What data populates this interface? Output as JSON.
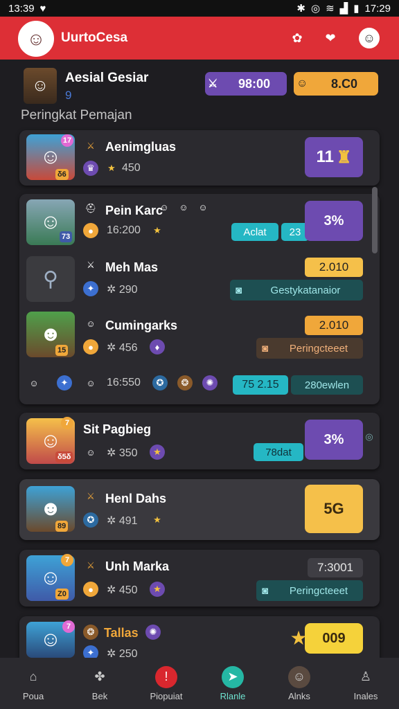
{
  "status_bar": {
    "time_left": "13:39",
    "time_right": "17:29"
  },
  "app": {
    "title": "UurtoCesa"
  },
  "header": {
    "name": "Aesial Gesiar",
    "sub": "9",
    "pill_1": "98:00",
    "pill_2": "8.C0"
  },
  "section_title": "Peringkat Pemajan",
  "cards": [
    {
      "name": "Aenimgluas",
      "stat": "450",
      "badge_corner": "17",
      "mini": "δ6",
      "box": "11"
    },
    {
      "name": "Pein Karc",
      "stat": "16:200",
      "mini": "73",
      "chip_a": "Aclat",
      "chip_b": "23",
      "box": "3%"
    },
    {
      "name": "Meh Mas",
      "stat": "290",
      "pill": "2.010",
      "chip": "Gestykatanaior"
    },
    {
      "name": "Cumingarks",
      "stat": "456",
      "mini": "15",
      "pill": "2.010",
      "chip": "Peringcteeet"
    },
    {
      "row_stat": "16:550",
      "chip_a": "75 2.15",
      "chip_b": "280ewlen"
    },
    {
      "name": "Sit Pagbieg",
      "stat": "350",
      "badge_corner": "7",
      "mini": "δ5δ",
      "chip": "78dat",
      "box": "3%"
    },
    {
      "name": "Henl Dahs",
      "stat": "491",
      "mini": "89",
      "box": "5G"
    },
    {
      "name": "Unh Marka",
      "stat": "450",
      "badge_corner": "7",
      "mini": "Z0",
      "pill": "7:3001",
      "chip": "Peringcteeet"
    },
    {
      "name": "Tallas",
      "stat": "250",
      "badge_corner": "7",
      "box": "009"
    }
  ],
  "nav": [
    {
      "label": "Poua",
      "icon": "home-icon"
    },
    {
      "label": "Bek",
      "icon": "puzzle-icon"
    },
    {
      "label": "Piopuiat",
      "icon": "alert-icon"
    },
    {
      "label": "Rlanle",
      "icon": "send-icon"
    },
    {
      "label": "Alnks",
      "icon": "avatar-icon"
    },
    {
      "label": "Inales",
      "icon": "person-icon"
    }
  ]
}
